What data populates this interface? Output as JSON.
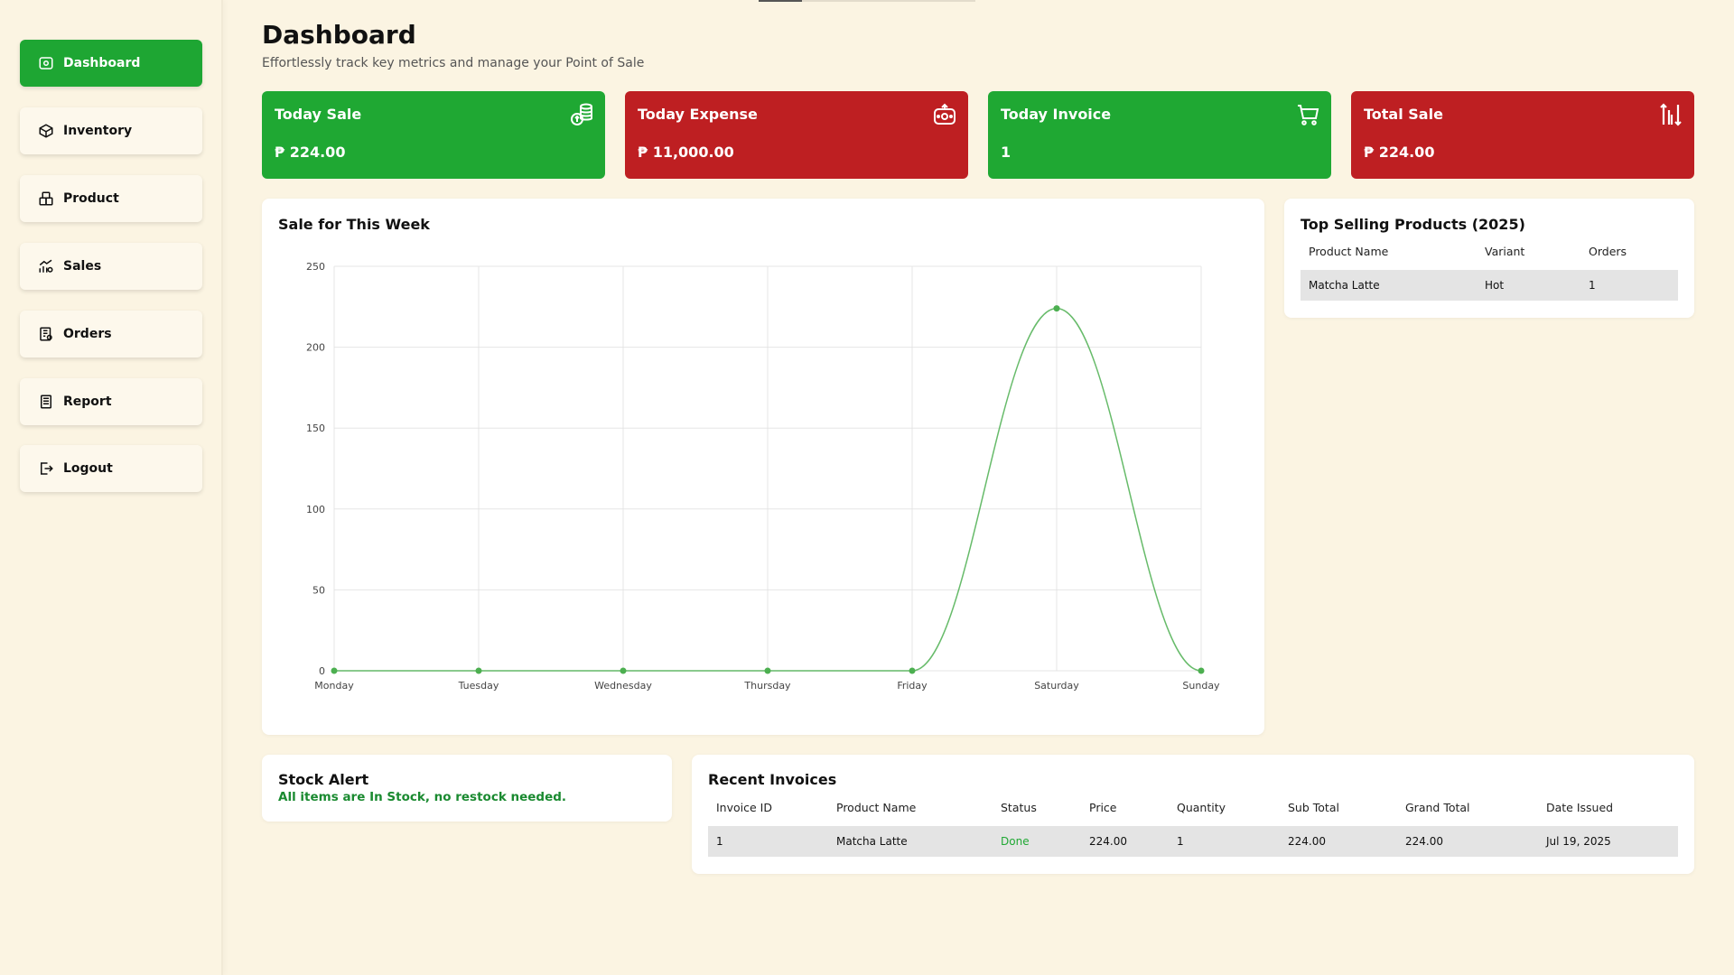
{
  "sidebar": {
    "items": [
      {
        "label": "Dashboard",
        "icon": "home-icon",
        "active": true
      },
      {
        "label": "Inventory",
        "icon": "box-icon",
        "active": false
      },
      {
        "label": "Product",
        "icon": "product-icon",
        "active": false
      },
      {
        "label": "Sales",
        "icon": "sales-chart-icon",
        "active": false
      },
      {
        "label": "Orders",
        "icon": "orders-icon",
        "active": false
      },
      {
        "label": "Report",
        "icon": "report-icon",
        "active": false
      },
      {
        "label": "Logout",
        "icon": "logout-icon",
        "active": false
      }
    ]
  },
  "header": {
    "title": "Dashboard",
    "subtitle": "Effortlessly track key metrics and manage your Point of Sale"
  },
  "stats": [
    {
      "label": "Today Sale",
      "value": "₱ 224.00",
      "color": "#1fa833",
      "icon": "coins-icon"
    },
    {
      "label": "Today Expense",
      "value": "₱ 11,000.00",
      "color": "#be1f22",
      "icon": "wallet-icon"
    },
    {
      "label": "Today Invoice",
      "value": "1",
      "color": "#1fa833",
      "icon": "cart-icon"
    },
    {
      "label": "Total Sale",
      "value": "₱ 224.00",
      "color": "#be1f22",
      "icon": "sort-arrows-icon"
    }
  ],
  "weekly_chart": {
    "title": "Sale for This Week"
  },
  "chart_data": {
    "type": "line",
    "title": "Sale for This Week",
    "categories": [
      "Monday",
      "Tuesday",
      "Wednesday",
      "Thursday",
      "Friday",
      "Saturday",
      "Sunday"
    ],
    "values": [
      0,
      0,
      0,
      0,
      0,
      224,
      0
    ],
    "ylim": [
      0,
      250
    ],
    "yticks": [
      0,
      50,
      100,
      150,
      200,
      250
    ],
    "xlabel": "",
    "ylabel": "",
    "grid": true,
    "color": "#4caf50"
  },
  "top_selling": {
    "title": "Top Selling Products (2025)",
    "columns": [
      "Product Name",
      "Variant",
      "Orders"
    ],
    "rows": [
      [
        "Matcha Latte",
        "Hot",
        "1"
      ]
    ]
  },
  "stock_alert": {
    "title": "Stock Alert",
    "message": "All items are In Stock, no restock needed."
  },
  "recent_invoices": {
    "title": "Recent Invoices",
    "columns": [
      "Invoice ID",
      "Product Name",
      "Status",
      "Price",
      "Quantity",
      "Sub Total",
      "Grand Total",
      "Date Issued"
    ],
    "rows": [
      [
        "1",
        "Matcha Latte",
        "Done",
        "224.00",
        "1",
        "224.00",
        "224.00",
        "Jul 19, 2025"
      ]
    ]
  }
}
